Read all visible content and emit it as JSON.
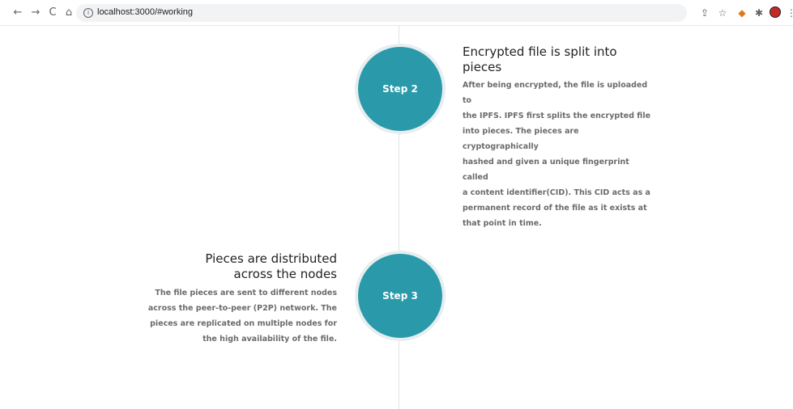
{
  "browser": {
    "url": "localhost:3000/#working",
    "back_glyph": "←",
    "forward_glyph": "→",
    "reload_glyph": "C",
    "home_glyph": "⌂",
    "info_glyph": "i",
    "icons": [
      "back-arrow-icon",
      "forward-arrow-icon",
      "reload-icon",
      "home-icon",
      "site-info-icon",
      "share-icon",
      "star-bookmark-icon",
      "metamask-fox-icon",
      "extensions-puzzle-icon",
      "profile-avatar-icon",
      "more-menu-icon"
    ]
  },
  "colors": {
    "step_circle": "#2a9aaa",
    "timeline": "#e4e4e4",
    "title_text": "#222222",
    "desc_text": "#6b6b6b"
  },
  "steps": [
    {
      "label": "Step 2",
      "title_line1": "Encrypted file is split into",
      "title_line2": "pieces",
      "desc": [
        "After being encrypted, the file is uploaded to",
        "the IPFS. IPFS first splits the encrypted file",
        "into pieces. The pieces are cryptographically",
        "hashed and given a unique fingerprint called",
        "a content identifier(CID). This CID acts as a",
        "permanent record of the file as it exists at",
        "that point in time."
      ]
    },
    {
      "label": "Step 3",
      "title_line1": "Pieces are distributed",
      "title_line2": "across the nodes",
      "desc": [
        "The file pieces are sent to different nodes",
        "across the peer-to-peer (P2P) network. The",
        "pieces are replicated on multiple nodes for",
        "the high availability of the file."
      ]
    }
  ]
}
